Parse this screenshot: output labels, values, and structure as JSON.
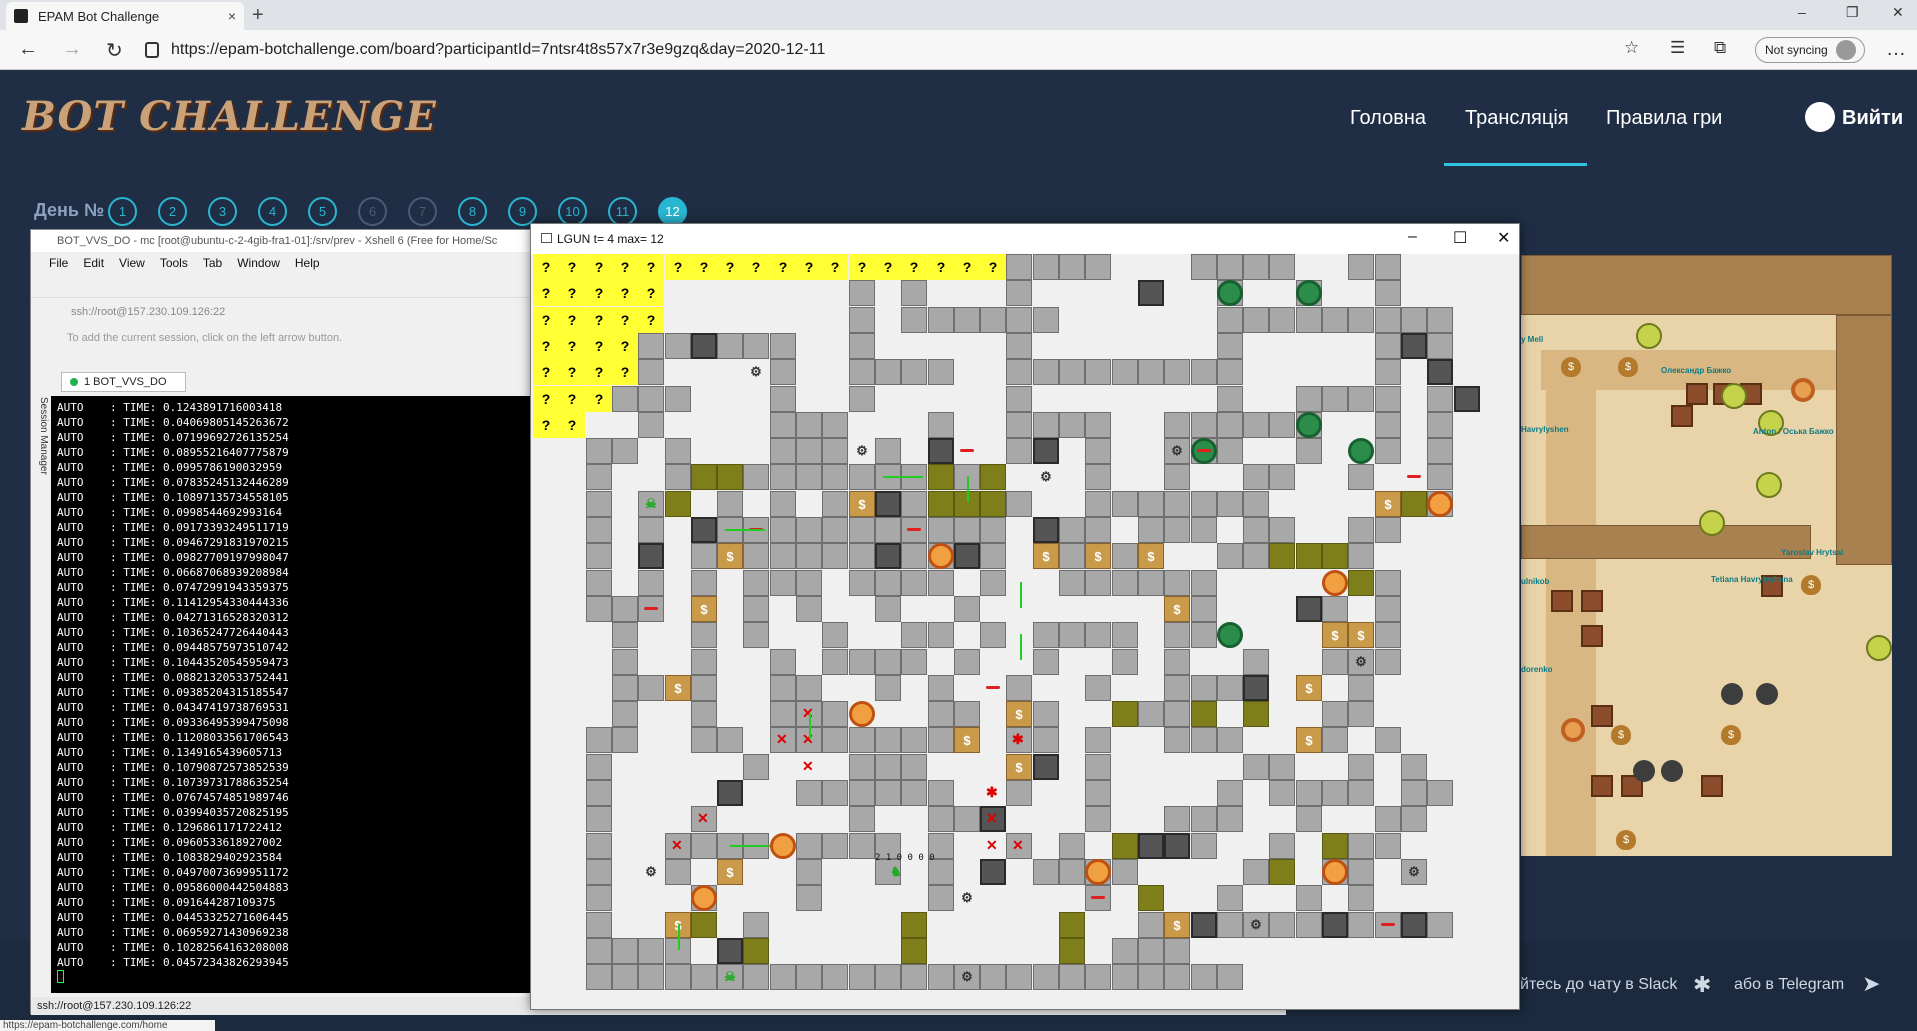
{
  "browser": {
    "tab_title": "EPAM Bot Challenge",
    "tab_close": "×",
    "new_tab": "+",
    "url": "https://epam-botchallenge.com/board?participantId=7ntsr4t8s57x7r3e9gzq&day=2020-12-11",
    "sync_label": "Not syncing",
    "status_url": "https://epam-botchallenge.com/home"
  },
  "site": {
    "logo_text": "BOT CHALLENGE",
    "nav": [
      "Головна",
      "Трансляція",
      "Правила гри"
    ],
    "exit_label": "Вийти",
    "day_label": "День №",
    "days": [
      "1",
      "2",
      "3",
      "4",
      "5",
      "6",
      "7",
      "8",
      "9",
      "10",
      "11",
      "12"
    ],
    "current_day": "12",
    "footer_slack": "йтесь до чату в Slack",
    "footer_telegram": "або в Telegram"
  },
  "board": {
    "player_names": [
      "y Mell",
      "Олександр Бажко",
      "Havrylyshen",
      "Anton / Оська Бажко",
      "ulnikob",
      "Yaroslav Hrytsai",
      "Tetiana Havrylyshena",
      "dorenko"
    ]
  },
  "xshell": {
    "title": "BOT_VVS_DO - mc [root@ubuntu-c-2-4gib-fra1-01]:/srv/prev - Xshell 6 (Free for Home/Sc",
    "menu": [
      "File",
      "Edit",
      "View",
      "Tools",
      "Tab",
      "Window",
      "Help"
    ],
    "host": "ssh://root@157.230.109.126:22",
    "hint": "To add the current session, click on the left arrow button.",
    "session_tab": "1 BOT_VVS_DO",
    "side_label": "Session Manager",
    "status": "ssh://root@157.230.109.126:22",
    "log": [
      "AUTO    : TIME: 0.1243891716003418",
      "AUTO    : TIME: 0.04069805145263672",
      "AUTO    : TIME: 0.07199692726135254",
      "AUTO    : TIME: 0.08955216407775879",
      "AUTO    : TIME: 0.0995786190032959",
      "AUTO    : TIME: 0.07835245132446289",
      "AUTO    : TIME: 0.10897135734558105",
      "AUTO    : TIME: 0.0998544692993164",
      "AUTO    : TIME: 0.09173393249511719",
      "AUTO    : TIME: 0.09467291831970215",
      "AUTO    : TIME: 0.09827709197998047",
      "AUTO    : TIME: 0.06687068939208984",
      "AUTO    : TIME: 0.07472991943359375",
      "AUTO    : TIME: 0.11412954330444336",
      "AUTO    : TIME: 0.04271316528320312",
      "AUTO    : TIME: 0.10365247726440443",
      "AUTO    : TIME: 0.09448575973510742",
      "AUTO    : TIME: 0.10443520545959473",
      "AUTO    : TIME: 0.08821320533752441",
      "AUTO    : TIME: 0.09385204315185547",
      "AUTO    : TIME: 0.04347419738769531",
      "AUTO    : TIME: 0.09336495399475098",
      "AUTO    : TIME: 0.11208033561706543",
      "AUTO    : TIME: 0.1349165439605713",
      "AUTO    : TIME: 0.10790872573852539",
      "AUTO    : TIME: 0.10739731788635254",
      "AUTO    : TIME: 0.07674574851989746",
      "AUTO    : TIME: 0.03994035720825195",
      "AUTO    : TIME: 0.1296861171722412",
      "AUTO    : TIME: 0.0960533618927002",
      "AUTO    : TIME: 0.1083829402923584",
      "AUTO    : TIME: 0.04970073699951172",
      "AUTO    : TIME: 0.09586000442504883",
      "AUTO    : TIME: 0.091644287109375",
      "AUTO    : TIME: 0.04453325271606445",
      "AUTO    : TIME: 0.06959271430969238",
      "AUTO    : TIME: 0.10282564163208008",
      "AUTO    : TIME: 0.04572343826293945"
    ]
  },
  "lgun": {
    "title": "LGUN t=  4 max= 12",
    "unknown_symbol": "?",
    "robot_numbers": "2 1 0 0 0 0"
  }
}
